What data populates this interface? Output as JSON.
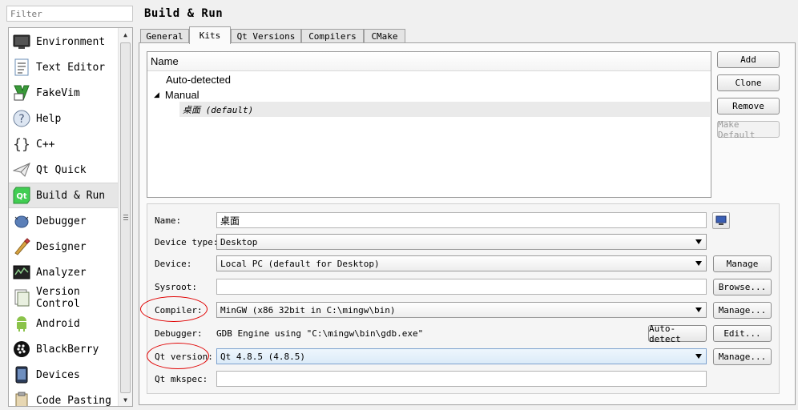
{
  "sidebar": {
    "filter_placeholder": "Filter",
    "items": [
      {
        "label": "Environment",
        "icon": "monitor-icon"
      },
      {
        "label": "Text Editor",
        "icon": "text-document-icon"
      },
      {
        "label": "FakeVim",
        "icon": "fakevim-icon"
      },
      {
        "label": "Help",
        "icon": "help-icon"
      },
      {
        "label": "C++",
        "icon": "braces-icon"
      },
      {
        "label": "Qt Quick",
        "icon": "paper-plane-icon"
      },
      {
        "label": "Build & Run",
        "icon": "qt-logo-icon"
      },
      {
        "label": "Debugger",
        "icon": "bug-icon"
      },
      {
        "label": "Designer",
        "icon": "designer-icon"
      },
      {
        "label": "Analyzer",
        "icon": "analyzer-icon"
      },
      {
        "label": "Version Control",
        "icon": "version-control-icon"
      },
      {
        "label": "Android",
        "icon": "android-icon"
      },
      {
        "label": "BlackBerry",
        "icon": "blackberry-icon"
      },
      {
        "label": "Devices",
        "icon": "devices-icon"
      },
      {
        "label": "Code Pasting",
        "icon": "paste-icon"
      }
    ],
    "selected": "Build & Run"
  },
  "page_title": "Build & Run",
  "tabs": [
    {
      "label": "General"
    },
    {
      "label": "Kits"
    },
    {
      "label": "Qt Versions"
    },
    {
      "label": "Compilers"
    },
    {
      "label": "CMake"
    }
  ],
  "active_tab": "Kits",
  "kit_tree": {
    "header": "Name",
    "groups": [
      "Auto-detected",
      "Manual"
    ],
    "manual_kit": "桌面 (default)"
  },
  "kit_buttons": {
    "add": "Add",
    "clone": "Clone",
    "remove": "Remove",
    "make_default": "Make Default"
  },
  "details": {
    "name_label": "Name:",
    "name_value": "桌面",
    "device_type_label": "Device type:",
    "device_type_value": "Desktop",
    "device_label": "Device:",
    "device_value": "Local PC (default for Desktop)",
    "sysroot_label": "Sysroot:",
    "sysroot_value": "",
    "compiler_label": "Compiler:",
    "compiler_value": "MinGW (x86 32bit in C:\\mingw\\bin)",
    "debugger_label": "Debugger:",
    "debugger_value": "GDB Engine using \"C:\\mingw\\bin\\gdb.exe\"",
    "qt_version_label": "Qt version:",
    "qt_version_value": "Qt 4.8.5 (4.8.5)",
    "qt_mkspec_label": "Qt mkspec:",
    "qt_mkspec_value": "",
    "manage_label": "Manage",
    "browse_label": "Browse...",
    "manage_dots_label": "Manage...",
    "auto_detect_label": "Auto-detect",
    "edit_label": "Edit..."
  },
  "colors": {
    "annotation": "#e00000",
    "selection": "#e6e6e6"
  }
}
